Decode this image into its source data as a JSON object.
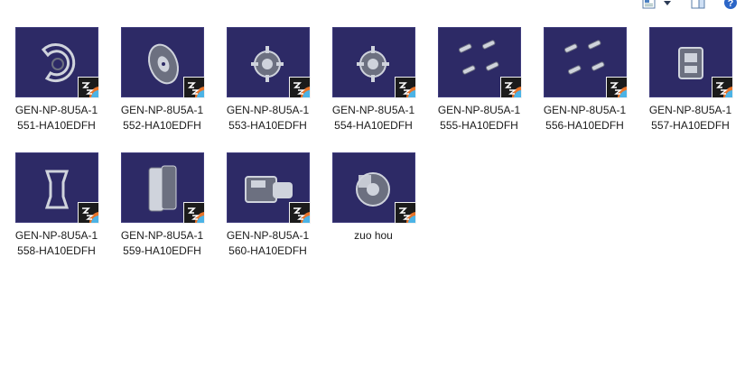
{
  "toolbar": {
    "icons": [
      "view-icon",
      "chevron-down-icon",
      "preview-pane-icon",
      "help-icon"
    ],
    "help_text": "?"
  },
  "files": [
    {
      "name": "GEN-NP-8U5A-1551-HA10EDFH",
      "part": "dust-shield"
    },
    {
      "name": "GEN-NP-8U5A-1552-HA10EDFH",
      "part": "brake-disc"
    },
    {
      "name": "GEN-NP-8U5A-1553-HA10EDFH",
      "part": "wheel-hub"
    },
    {
      "name": "GEN-NP-8U5A-1554-HA10EDFH",
      "part": "wheel-hub"
    },
    {
      "name": "GEN-NP-8U5A-1555-HA10EDFH",
      "part": "pins"
    },
    {
      "name": "GEN-NP-8U5A-1556-HA10EDFH",
      "part": "pins"
    },
    {
      "name": "GEN-NP-8U5A-1557-HA10EDFH",
      "part": "caliper"
    },
    {
      "name": "GEN-NP-8U5A-1558-HA10EDFH",
      "part": "bracket"
    },
    {
      "name": "GEN-NP-8U5A-1559-HA10EDFH",
      "part": "brake-pads"
    },
    {
      "name": "GEN-NP-8U5A-1560-HA10EDFH",
      "part": "caliper-assembly"
    },
    {
      "name": "zuo hou",
      "part": "brake-assembly"
    }
  ],
  "colors": {
    "thumb_bg": "#2d2a66",
    "part_light": "#cfd3dc",
    "part_dark": "#6c7080",
    "label": "#1a1a1a"
  }
}
